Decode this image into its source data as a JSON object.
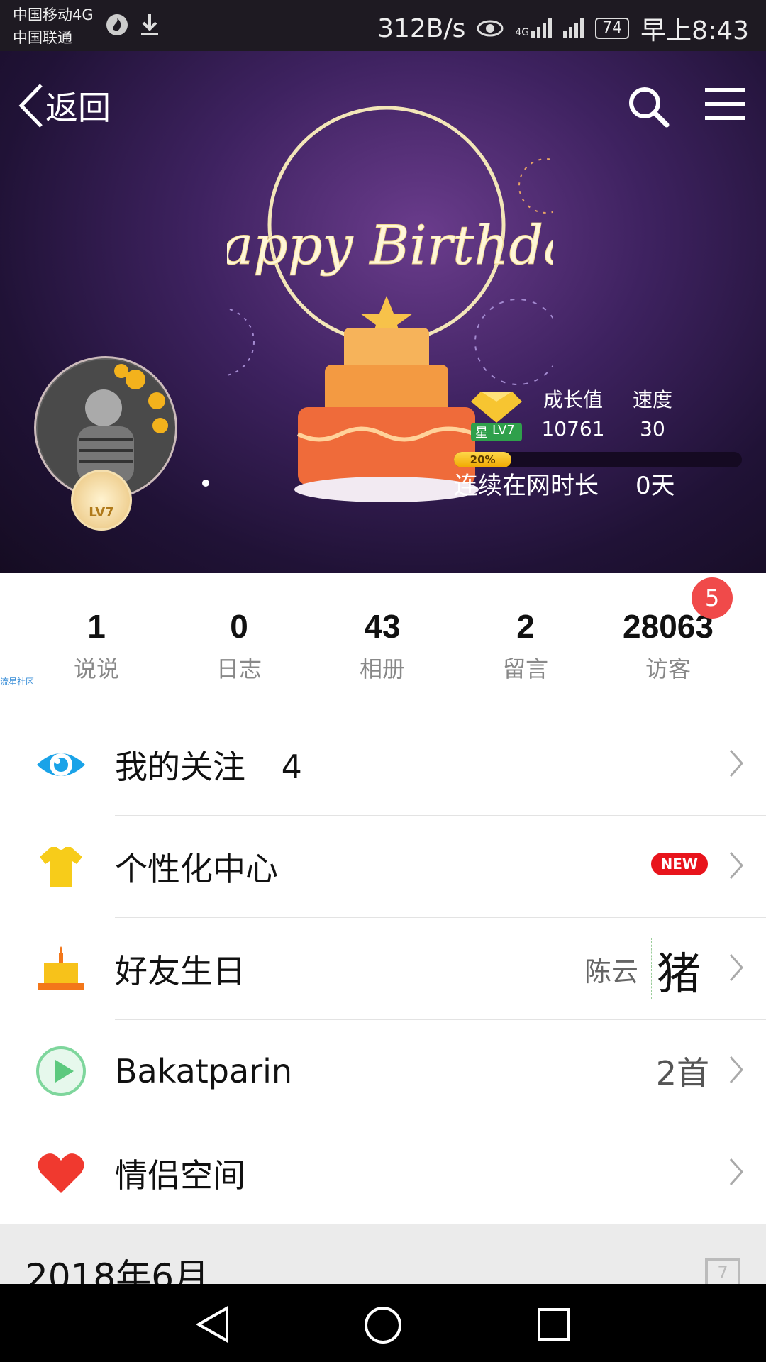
{
  "status_bar": {
    "carrier1": "中国移动4G",
    "carrier2": "中国联通",
    "speed": "312B/s",
    "signal": "4G",
    "battery": "74",
    "time": "早上8:43"
  },
  "header": {
    "back_label": "返回",
    "banner_caption": "Happy Birthday",
    "level_badge": "LV7",
    "vip_label": "星",
    "growth_label": "成长值",
    "growth_value": "10761",
    "speed_label": "速度",
    "speed_value": "30",
    "progress_text": "20%",
    "progress_fraction": 0.2,
    "online_label": "连续在网时长",
    "online_value": "0天"
  },
  "counts": [
    {
      "num": "1",
      "label": "说说"
    },
    {
      "num": "0",
      "label": "日志"
    },
    {
      "num": "43",
      "label": "相册"
    },
    {
      "num": "2",
      "label": "留言"
    },
    {
      "num": "28063",
      "label": "访客"
    }
  ],
  "visitor_badge": "5",
  "community_label": "流星社区",
  "menu": [
    {
      "label": "我的关注",
      "count": "4",
      "icon": "eye-icon"
    },
    {
      "label": "个性化中心",
      "badge": "NEW",
      "icon": "tshirt-icon"
    },
    {
      "label": "好友生日",
      "extra": "陈云",
      "extra_glyph": "猪",
      "icon": "cake-icon"
    },
    {
      "label": "Bakatparin",
      "extra": "2首",
      "icon": "play-icon"
    },
    {
      "label": "情侣空间",
      "icon": "heart-icon"
    }
  ],
  "date_section": "2018年6月",
  "calendar_day": "7"
}
